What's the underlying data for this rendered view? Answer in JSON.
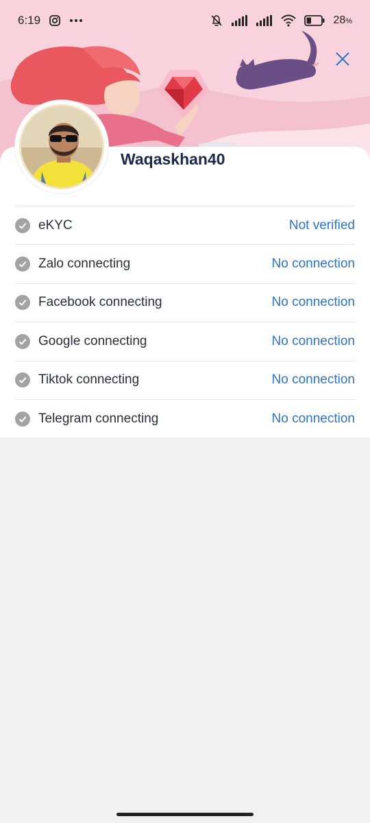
{
  "status_bar": {
    "time": "6:19",
    "battery": "28",
    "battery_unit": "%",
    "icons": [
      "instagram-icon",
      "more-icon",
      "mute-bell-icon",
      "signal-icon",
      "signal-icon",
      "wifi-icon",
      "battery-icon"
    ]
  },
  "profile": {
    "username": "Waqaskhan40"
  },
  "rows": [
    {
      "label": "eKYC",
      "status": "Not verified"
    },
    {
      "label": "Zalo connecting",
      "status": "No connection"
    },
    {
      "label": "Facebook connecting",
      "status": "No connection"
    },
    {
      "label": "Google connecting",
      "status": "No connection"
    },
    {
      "label": "Tiktok connecting",
      "status": "No connection"
    },
    {
      "label": "Telegram connecting",
      "status": "No connection"
    }
  ],
  "colors": {
    "accent": "#2f74c4",
    "header_bg": "#f8d3dd",
    "title": "#1b2a4a",
    "check": "#a3a3a3"
  }
}
